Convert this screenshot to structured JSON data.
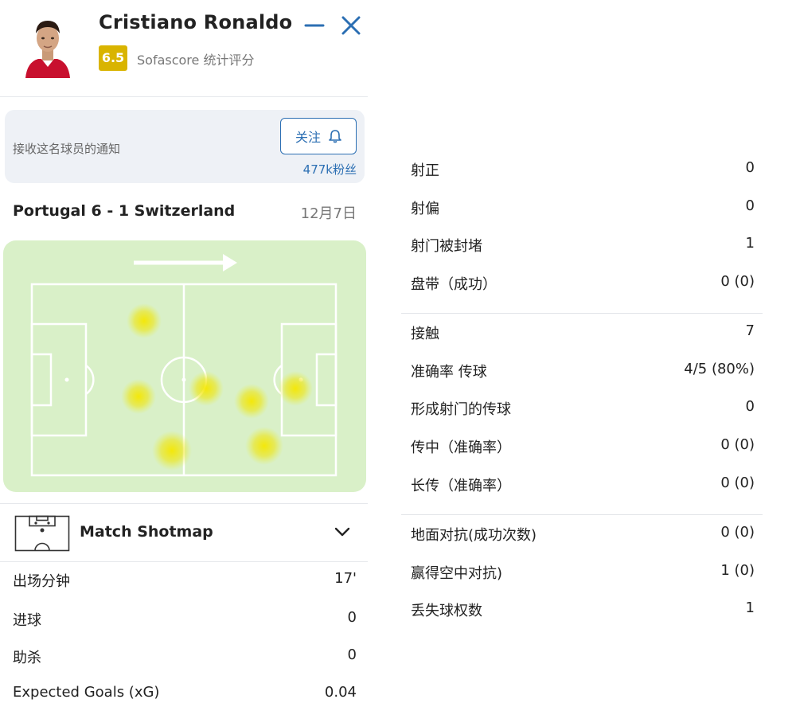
{
  "player": {
    "name": "Cristiano Ronaldo",
    "rating": "6.5",
    "rating_label": "Sofascore 统计评分"
  },
  "follow": {
    "prompt": "接收这名球员的通知",
    "button_label": "关注",
    "followers": "477k粉丝"
  },
  "match": {
    "title": "Portugal 6 - 1 Switzerland",
    "date": "12月7日"
  },
  "shotmap": {
    "label": "Match Shotmap"
  },
  "left_stats": [
    {
      "label": "出场分钟",
      "value": "17'"
    },
    {
      "label": "进球",
      "value": "0"
    },
    {
      "label": "助杀",
      "value": "0"
    },
    {
      "label": "Expected Goals (xG)",
      "value": "0.04"
    }
  ],
  "right_stats_group1": [
    {
      "label": "射正",
      "value": "0"
    },
    {
      "label": "射偏",
      "value": "0"
    },
    {
      "label": "射门被封堵",
      "value": "1"
    },
    {
      "label": "盘带（成功）",
      "value": "0 (0)"
    }
  ],
  "right_stats_group2": [
    {
      "label": "接触",
      "value": "7"
    },
    {
      "label": "准确率 传球",
      "value": "4/5 (80%)"
    },
    {
      "label": "形成射门的传球",
      "value": "0"
    },
    {
      "label": "传中（准确率）",
      "value": "0 (0)"
    },
    {
      "label": "长传（准确率）",
      "value": "0 (0)"
    }
  ],
  "right_stats_group3": [
    {
      "label": "地面对抗(成功次数)",
      "value": "0 (0)"
    },
    {
      "label": "赢得空中对抗)",
      "value": "1 (0)"
    },
    {
      "label": "丢失球权数",
      "value": "1"
    }
  ],
  "colors": {
    "accent": "#2c6fb3",
    "rating_bg": "#d9b400",
    "pitch": "#d9f0c8",
    "heat": "#f5e800"
  }
}
